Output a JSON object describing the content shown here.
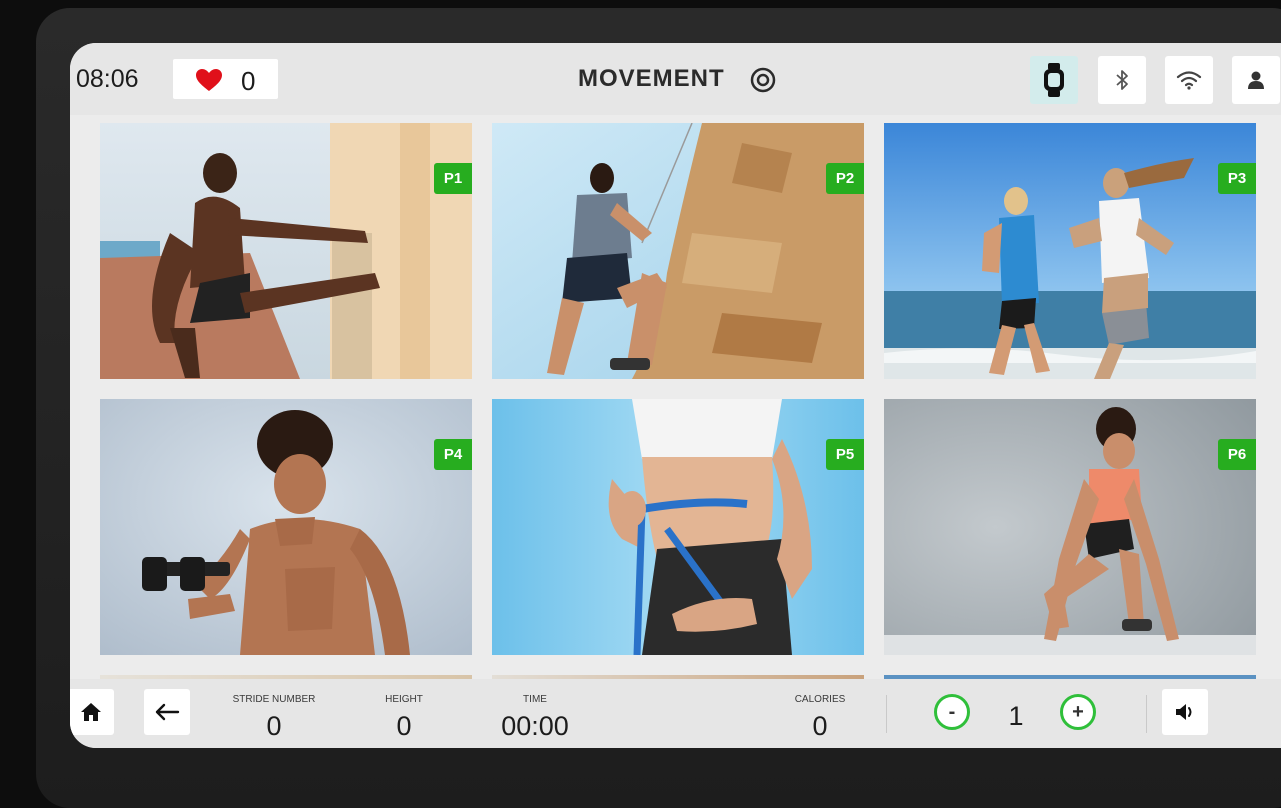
{
  "status": {
    "time": "08:06",
    "heart_rate": "0"
  },
  "brand": {
    "name": "MOVEMENT"
  },
  "toolbar": {
    "icons": [
      "watch-icon",
      "bluetooth-icon",
      "wifi-icon",
      "user-icon"
    ],
    "active": "watch-icon"
  },
  "programs": [
    {
      "badge": "P1",
      "subject": "man stretching leg on wall"
    },
    {
      "badge": "P2",
      "subject": "man rock climbing"
    },
    {
      "badge": "P3",
      "subject": "couple running on beach"
    },
    {
      "badge": "P4",
      "subject": "man lifting dumbbell"
    },
    {
      "badge": "P5",
      "subject": "woman measuring waist"
    },
    {
      "badge": "P6",
      "subject": "woman in sprint start"
    }
  ],
  "metrics": {
    "stride_label": "STRIDE NUMBER",
    "stride_value": "0",
    "height_label": "HEIGHT",
    "height_value": "0",
    "time_label": "TIME",
    "time_value": "00:00",
    "calories_label": "CALORIES",
    "calories_value": "0"
  },
  "level": {
    "value": "1",
    "minus": "-",
    "plus": "+"
  },
  "colors": {
    "badge": "#27ad1f",
    "heart": "#e0101a",
    "stepper_ring": "#2fbf3a"
  }
}
